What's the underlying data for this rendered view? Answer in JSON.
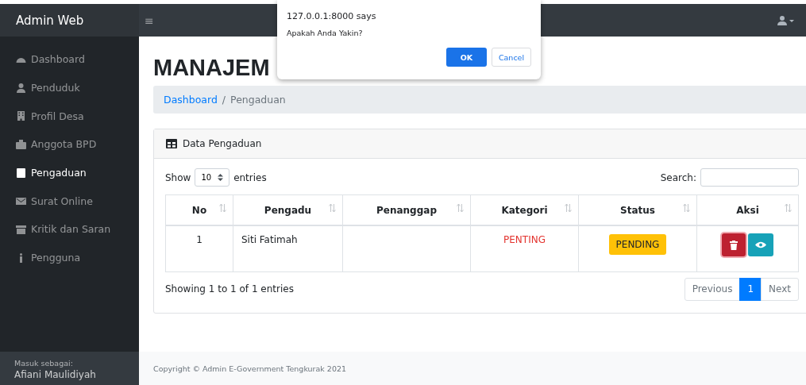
{
  "topbar": {
    "brand": "Admin Web",
    "menu_toggle": "≡"
  },
  "sidebar": {
    "items": [
      {
        "label": "Dashboard",
        "selected": false
      },
      {
        "label": "Penduduk",
        "selected": false
      },
      {
        "label": "Profil Desa",
        "selected": false
      },
      {
        "label": "Anggota BPD",
        "selected": false
      },
      {
        "label": "Pengaduan",
        "selected": true
      },
      {
        "label": "Surat Online",
        "selected": false
      },
      {
        "label": "Kritik dan Saran",
        "selected": false
      },
      {
        "label": "Pengguna",
        "selected": false
      }
    ],
    "footer": {
      "caption": "Masuk sebagai:",
      "user": "Afiani Maulidiyah"
    }
  },
  "page": {
    "heading": "MANAJEM",
    "breadcrumb": [
      {
        "label": "Dashboard",
        "kind": "link"
      },
      {
        "label": "/",
        "kind": "separator"
      },
      {
        "label": "Pengaduan",
        "kind": "current"
      }
    ]
  },
  "card": {
    "title": "Data Pengaduan",
    "length": {
      "before": "Show",
      "value": "10",
      "after": "entries"
    },
    "search": {
      "label": "Search:"
    },
    "table": {
      "columns": [
        {
          "label": "No"
        },
        {
          "label": "Pengadu"
        },
        {
          "label": "Penanggap"
        },
        {
          "label": "Kategori"
        },
        {
          "label": "Status"
        },
        {
          "label": "Aksi"
        }
      ],
      "rows": [
        {
          "no": "1",
          "pengadu": "Siti Fatimah",
          "kategori": "PENTING",
          "status": "PENDING"
        }
      ]
    },
    "info": "Showing 1 to 1 of 1 entries",
    "pagination": {
      "previous": {
        "label": "Previous",
        "disabled": true
      },
      "pages": [
        {
          "label": "1",
          "selected": true
        }
      ],
      "next": {
        "label": "Next",
        "disabled": true
      }
    }
  },
  "footer": {
    "copyright": "Copyright © Admin E-Government Tengkurak 2021"
  },
  "dialog": {
    "origin": "127.0.0.1:8000 says",
    "message": "Apakah Anda Yakin?",
    "buttons": [
      {
        "label": "OK",
        "kind": "primary"
      },
      {
        "label": "Cancel",
        "kind": "secondary"
      }
    ]
  }
}
